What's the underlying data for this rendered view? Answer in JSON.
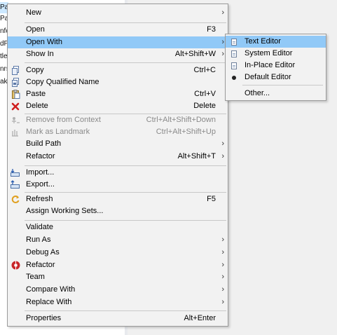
{
  "tree": [
    "Pa",
    "Pa",
    "nfo",
    "dP",
    "tle",
    "nrs",
    "ak"
  ],
  "menu": {
    "items": [
      {
        "label": "New",
        "shortcut": "",
        "submenu": true
      },
      {
        "label": "Open",
        "shortcut": "F3",
        "submenu": false
      },
      {
        "label": "Open With",
        "shortcut": "",
        "submenu": true
      },
      {
        "label": "Show In",
        "shortcut": "Alt+Shift+W",
        "submenu": true
      },
      {
        "label": "Copy",
        "shortcut": "Ctrl+C",
        "submenu": false
      },
      {
        "label": "Copy Qualified Name",
        "shortcut": "",
        "submenu": false
      },
      {
        "label": "Paste",
        "shortcut": "Ctrl+V",
        "submenu": false
      },
      {
        "label": "Delete",
        "shortcut": "Delete",
        "submenu": false
      },
      {
        "label": "Remove from Context",
        "shortcut": "Ctrl+Alt+Shift+Down",
        "submenu": false
      },
      {
        "label": "Mark as Landmark",
        "shortcut": "Ctrl+Alt+Shift+Up",
        "submenu": false
      },
      {
        "label": "Build Path",
        "shortcut": "",
        "submenu": true
      },
      {
        "label": "Refactor",
        "shortcut": "Alt+Shift+T",
        "submenu": true
      },
      {
        "label": "Import...",
        "shortcut": "",
        "submenu": false
      },
      {
        "label": "Export...",
        "shortcut": "",
        "submenu": false
      },
      {
        "label": "Refresh",
        "shortcut": "F5",
        "submenu": false
      },
      {
        "label": "Assign Working Sets...",
        "shortcut": "",
        "submenu": false
      },
      {
        "label": "Validate",
        "shortcut": "",
        "submenu": false
      },
      {
        "label": "Run As",
        "shortcut": "",
        "submenu": true
      },
      {
        "label": "Debug As",
        "shortcut": "",
        "submenu": true
      },
      {
        "label": "Refactor",
        "shortcut": "",
        "submenu": true
      },
      {
        "label": "Team",
        "shortcut": "",
        "submenu": true
      },
      {
        "label": "Compare With",
        "shortcut": "",
        "submenu": true
      },
      {
        "label": "Replace With",
        "shortcut": "",
        "submenu": true
      },
      {
        "label": "Properties",
        "shortcut": "Alt+Enter",
        "submenu": false
      }
    ],
    "submenu_arrow": "›"
  },
  "open_with_submenu": {
    "items": [
      {
        "label": "Text Editor"
      },
      {
        "label": "System Editor"
      },
      {
        "label": "In-Place Editor"
      },
      {
        "label": "Default Editor"
      },
      {
        "label": "Other..."
      }
    ]
  },
  "colors": {
    "highlight": "#91c9f7",
    "menu_bg": "#f2f2f2",
    "disabled_text": "#8a8a8a",
    "delete_icon": "#d02020"
  }
}
